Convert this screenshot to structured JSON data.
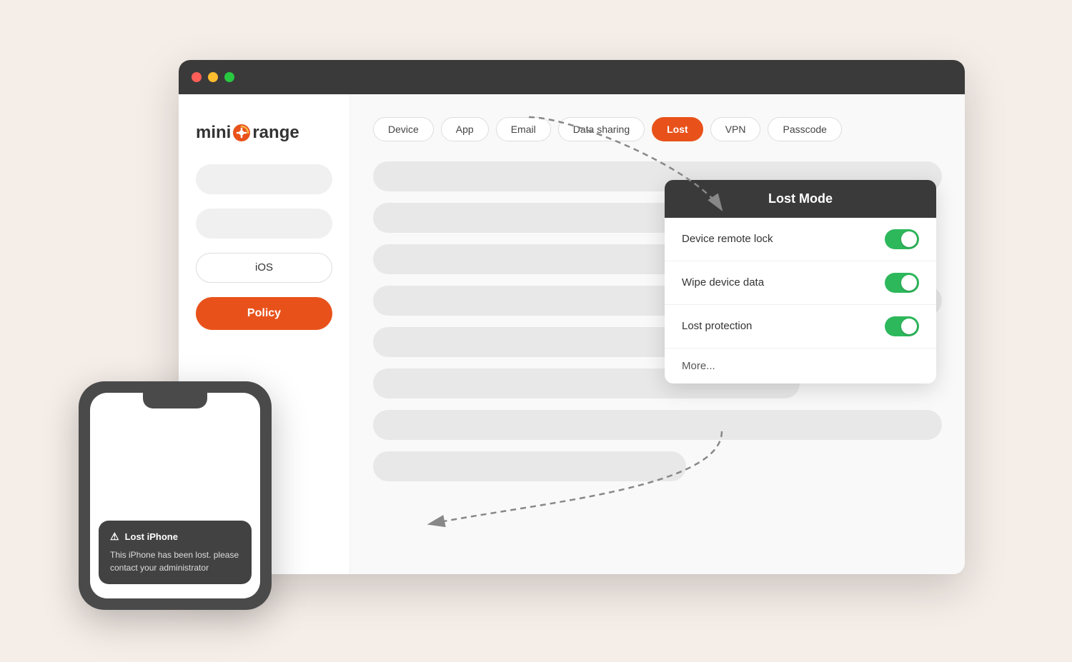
{
  "scene": {
    "background_color": "#f5ede8"
  },
  "browser": {
    "traffic_lights": [
      "green",
      "yellow",
      "red"
    ],
    "colors": {
      "green": "#28c840",
      "yellow": "#febc2e",
      "red": "#ff5f57",
      "titlebar": "#3a3a3a"
    }
  },
  "sidebar": {
    "logo": {
      "text_before": "mini",
      "text_after": "range",
      "icon": "orange-circle"
    },
    "input1_placeholder": "",
    "input2_placeholder": "",
    "select_value": "iOS",
    "button_label": "Policy"
  },
  "tabs": [
    {
      "label": "Device",
      "active": false
    },
    {
      "label": "App",
      "active": false
    },
    {
      "label": "Email",
      "active": false
    },
    {
      "label": "Data sharing",
      "active": false
    },
    {
      "label": "Lost",
      "active": true
    },
    {
      "label": "VPN",
      "active": false
    },
    {
      "label": "Passcode",
      "active": false
    }
  ],
  "popup": {
    "title": "Lost Mode",
    "rows": [
      {
        "label": "Device remote lock",
        "toggle": true
      },
      {
        "label": "Wipe device data",
        "toggle": true
      },
      {
        "label": "Lost protection",
        "toggle": true
      },
      {
        "label": "More...",
        "toggle": false
      }
    ]
  },
  "phone": {
    "notification": {
      "title": "Lost iPhone",
      "warning_icon": "⚠",
      "body": "This iPhone has been lost. please contact your administrator"
    }
  }
}
